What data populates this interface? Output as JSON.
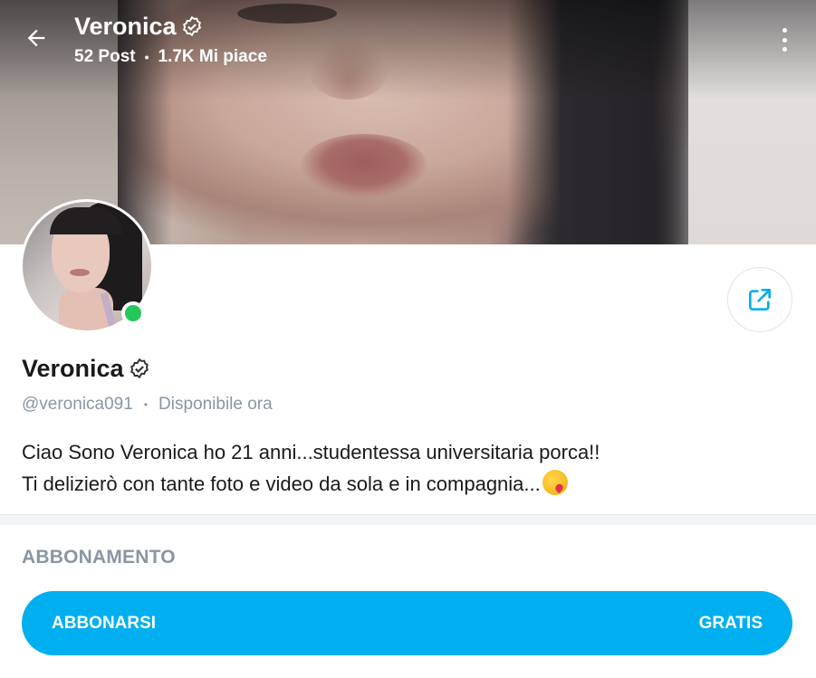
{
  "header": {
    "title": "Veronica",
    "posts": "52 Post",
    "likes": "1.7K Mi piace",
    "separator": "•"
  },
  "icons": {
    "back": "arrow-left-icon",
    "verified": "verified-badge-icon",
    "more": "more-vertical-icon",
    "share": "share-icon"
  },
  "profile": {
    "name": "Veronica",
    "handle": "@veronica091",
    "separator": "•",
    "status": "Disponibile ora",
    "online": true,
    "bio_line1": "Ciao Sono Veronica ho 21 anni...studentessa universitaria porca!!",
    "bio_line2": "Ti delizierò con tante foto e video da sola e in compagnia..."
  },
  "subscription": {
    "section_title": "ABBONAMENTO",
    "button_label": "ABBONARSI",
    "price_label": "GRATIS"
  },
  "colors": {
    "accent": "#00aff0",
    "online": "#24c75a",
    "muted_text": "#8a96a3"
  }
}
